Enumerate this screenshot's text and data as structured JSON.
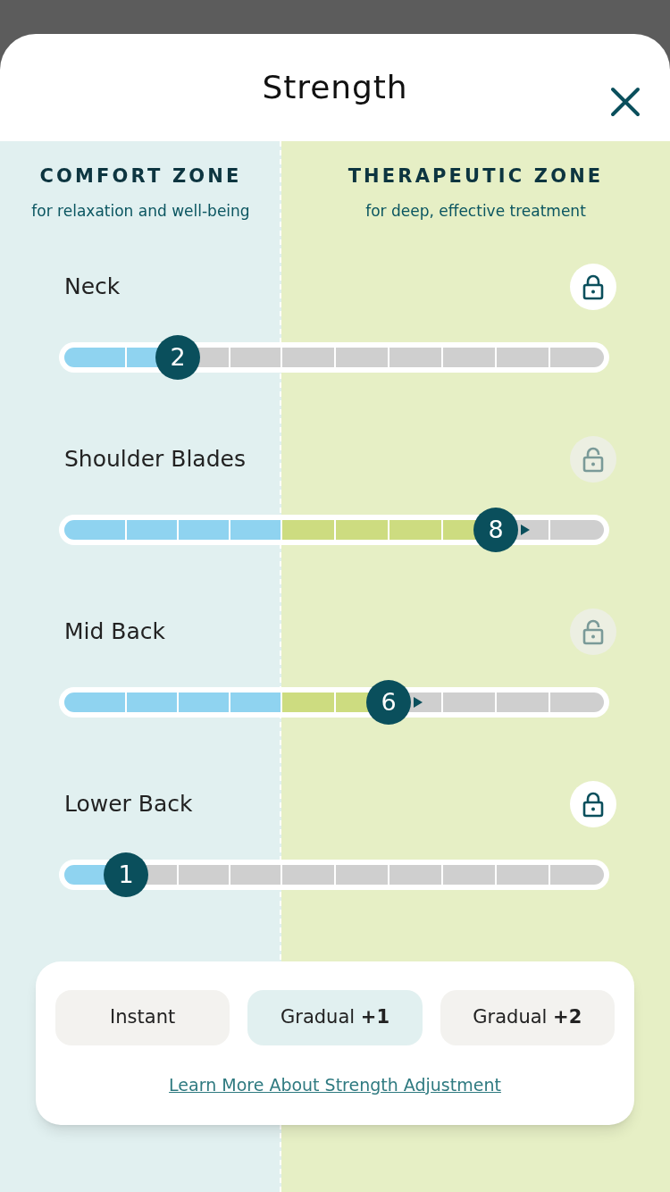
{
  "sheet": {
    "title": "Strength"
  },
  "zones": [
    {
      "title": "COMFORT ZONE",
      "subtitle": "for relaxation and well-being"
    },
    {
      "title": "THERAPEUTIC ZONE",
      "subtitle": "for deep, effective treatment"
    }
  ],
  "areas": [
    {
      "label": "Neck",
      "locked": true,
      "level": 0.2,
      "value": "2",
      "rising": false
    },
    {
      "label": "Shoulder Blades",
      "locked": false,
      "level": 0.8,
      "value": "8",
      "rising": true
    },
    {
      "label": "Mid Back",
      "locked": false,
      "level": 0.6,
      "value": "6",
      "rising": true
    },
    {
      "label": "Lower Back",
      "locked": true,
      "level": 0.1,
      "value": "1",
      "rising": false
    }
  ],
  "modes": [
    {
      "label": "Instant",
      "selected": false
    },
    {
      "label": "Gradual **+1**",
      "selected": true
    },
    {
      "label": "Gradual **+2**",
      "selected": false
    }
  ],
  "link": "Learn More About Strength Adjustment"
}
